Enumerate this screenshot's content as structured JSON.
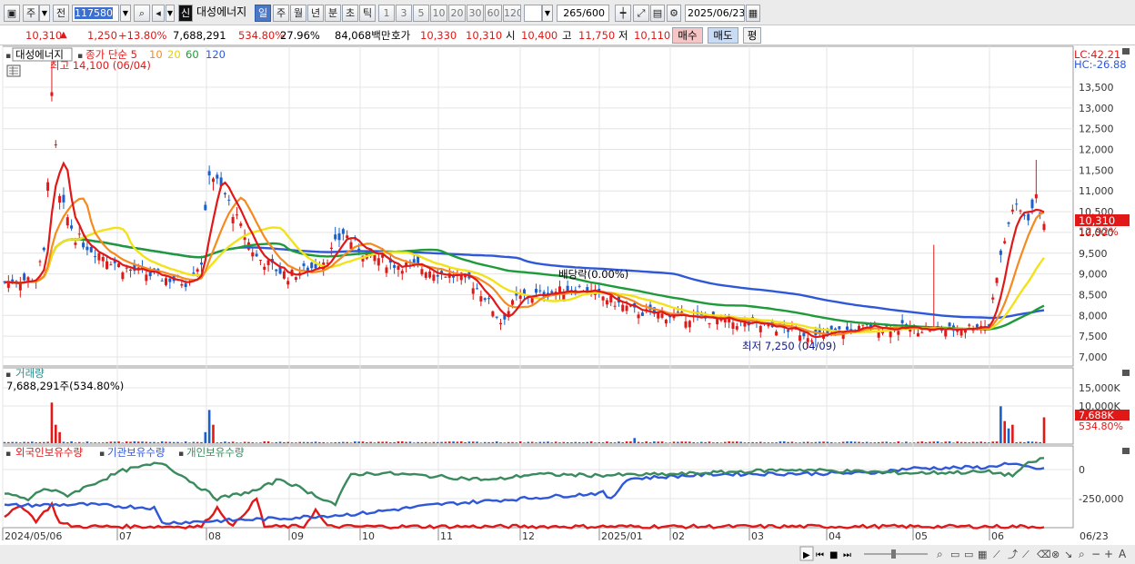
{
  "toolbar": {
    "market_btn": "주",
    "prev_btn": "전",
    "code_value": "117580",
    "new_btn": "신",
    "stock_name": "대성에너지",
    "periods": [
      "일",
      "주",
      "월",
      "년",
      "분",
      "초",
      "틱"
    ],
    "intervals": [
      "1",
      "3",
      "5",
      "10",
      "20",
      "30",
      "60",
      "120"
    ],
    "count_value": "265",
    "count_total": "/600",
    "date_value": "2025/06/23"
  },
  "quote": {
    "price": "10,310",
    "up_arrow": "▲",
    "change": "1,250",
    "change_pct": "+13.80%",
    "volume": "7,688,291",
    "vol_ratio": "534.80%",
    "turnover": "27.96%",
    "amount": "84,068백만",
    "hoga_label": "호가",
    "ask": "10,330",
    "bid": "10,310",
    "open_label": "시",
    "open": "10,400",
    "high_label": "고",
    "high": "11,750",
    "low_label": "저",
    "low": "10,110",
    "buy_btn": "매수",
    "sell_btn": "매도",
    "eval_btn": "평"
  },
  "price_panel": {
    "legend_name": "대성에너지",
    "legend_close": "종가 단순 5",
    "legend_ma": [
      "10",
      "20",
      "60",
      "120"
    ],
    "hi_note": "최고 14,100 (06/04)",
    "lo_note": "최저 7,250 (04/09)",
    "dividend_note": "배당락(0.00%)",
    "lc": "LC:42.21",
    "hc": "HC:-26.88",
    "current_tag": "10,310",
    "current_pct": "12.92%",
    "y_ticks": [
      "13,500",
      "13,000",
      "12,500",
      "12,000",
      "11,500",
      "11,000",
      "10,500",
      "10,000",
      "9,500",
      "9,000",
      "8,500",
      "8,000",
      "7,500",
      "7,000"
    ]
  },
  "volume_panel": {
    "title": "거래량",
    "subtitle": "7,688,291주(534.80%)",
    "y_ticks": [
      "15,000K",
      "10,000K"
    ],
    "current_tag": "7,688K",
    "current_pct": "534.80%"
  },
  "holding_panel": {
    "legend": [
      "외국인보유수량",
      "기관보유수량",
      "개인보유수량"
    ],
    "y_ticks": [
      "0",
      "-250,000"
    ]
  },
  "x_axis": [
    "2024/05/06",
    "07",
    "08",
    "09",
    "10",
    "11",
    "12",
    "2025/01",
    "02",
    "03",
    "04",
    "05",
    "06",
    "06/23"
  ],
  "colors": {
    "up": "#e01818",
    "down": "#1a5fcc",
    "ma5": "#e01818",
    "ma10": "#f58a1f",
    "ma20": "#f2e21a",
    "ma60": "#1e9a3a",
    "ma120": "#2f58d8",
    "green_line": "#3a8a5e"
  }
}
